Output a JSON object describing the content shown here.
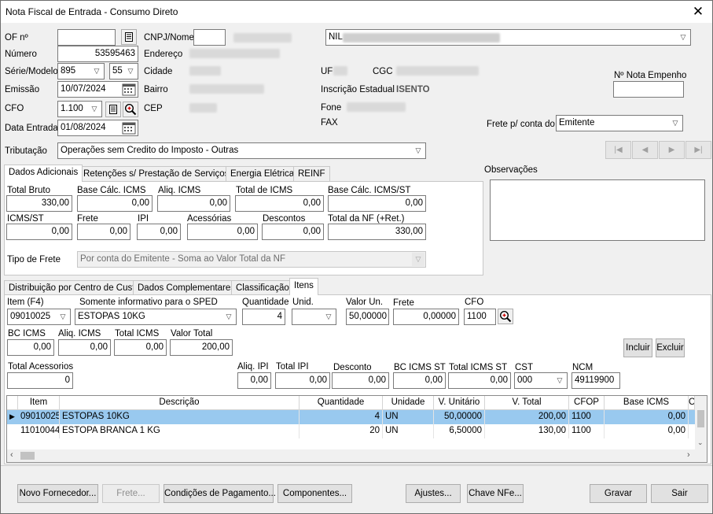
{
  "window": {
    "title": "Nota Fiscal de Entrada - Consumo Direto",
    "close_glyph": "✕"
  },
  "header": {
    "of_label": "OF nº",
    "of_value": "",
    "numero_label": "Número",
    "numero_value": "53595463",
    "serie_label": "Série/Modelo",
    "serie_value": "895",
    "modelo_value": "55",
    "emissao_label": "Emissão",
    "emissao_value": "10/07/2024",
    "cfo_label": "CFO",
    "cfo_value": "1.100",
    "data_entrada_label": "Data Entrada",
    "data_entrada_value": "01/08/2024",
    "tributacao_label": "Tributação",
    "tributacao_value": "Operações sem Credito do Imposto - Outras",
    "cnpj_label": "CNPJ/Nome",
    "cnpj_value": "",
    "nome_value": "NIL",
    "endereco_label": "Endereço",
    "cidade_label": "Cidade",
    "bairro_label": "Bairro",
    "cep_label": "CEP",
    "uf_label": "UF",
    "cgc_label": "CGC",
    "ie_label": "Inscrição Estadual",
    "ie_value": "ISENTO",
    "fone_label": "Fone",
    "fax_label": "FAX",
    "empenho_label": "Nº Nota Empenho",
    "empenho_value": "",
    "frete_conta_label": "Frete p/ conta do",
    "frete_conta_value": "Emitente",
    "observacoes_label": "Observações"
  },
  "nav_buttons": [
    "|◀",
    "◀",
    "▶",
    "▶|"
  ],
  "tabs_top": [
    "Dados Adicionais",
    "Retenções s/ Prestação de Serviços",
    "Energia Elétrica",
    "REINF"
  ],
  "dados_adicionais": {
    "total_bruto_label": "Total Bruto",
    "total_bruto": "330,00",
    "base_icms_label": "Base Cálc. ICMS",
    "base_icms": "0,00",
    "aliq_icms_label": "Aliq. ICMS",
    "aliq_icms": "0,00",
    "total_icms_label": "Total de ICMS",
    "total_icms": "0,00",
    "base_icms_st_label": "Base Cálc. ICMS/ST",
    "base_icms_st": "0,00",
    "icms_st_label": "ICMS/ST",
    "icms_st": "0,00",
    "frete_label": "Frete",
    "frete": "0,00",
    "ipi_label": "IPI",
    "ipi": "0,00",
    "acessorias_label": "Acessórias",
    "acessorias": "0,00",
    "descontos_label": "Descontos",
    "descontos": "0,00",
    "total_nf_label": "Total da NF (+Ret.)",
    "total_nf": "330,00",
    "tipo_frete_label": "Tipo de Frete",
    "tipo_frete_value": "Por conta do Emitente - Soma ao Valor Total da NF"
  },
  "tabs_bottom": [
    "Distribuição por Centro de Custo",
    "Dados Complementares",
    "Classificação",
    "Itens"
  ],
  "itens": {
    "item_label": "Item (F4)",
    "item_value": "09010025",
    "sped_label": "Somente informativo para o SPED",
    "sped_value": "ESTOPAS 10KG",
    "quantidade_label": "Quantidade",
    "quantidade_value": "4",
    "unid_label": "Unid.",
    "unid_value": "",
    "valor_un_label": "Valor Un.",
    "valor_un_value": "50,00000",
    "frete_label": "Frete",
    "frete_value": "0,00000",
    "cfo_label": "CFO",
    "cfo_value": "1100",
    "bc_icms_label": "BC ICMS",
    "bc_icms_value": "0,00",
    "aliq_icms_label": "Aliq. ICMS",
    "aliq_icms_value": "0,00",
    "total_icms_label": "Total ICMS",
    "total_icms_value": "0,00",
    "valor_total_label": "Valor Total",
    "valor_total_value": "200,00",
    "incluir_label": "Incluir",
    "excluir_label": "Excluir",
    "total_acessorios_label": "Total Acessorios",
    "total_acessorios_value": "0",
    "aliq_ipi_label": "Aliq. IPI",
    "aliq_ipi_value": "0,00",
    "total_ipi_label": "Total IPI",
    "total_ipi_value": "0,00",
    "desconto_label": "Desconto",
    "desconto_value": "0,00",
    "bc_icms_st_label": "BC ICMS ST",
    "bc_icms_st_value": "0,00",
    "total_icms_st_label": "Total ICMS ST",
    "total_icms_st_value": "0,00",
    "cst_label": "CST",
    "cst_value": "000",
    "ncm_label": "NCM",
    "ncm_value": "49119900"
  },
  "grid": {
    "columns": [
      "Item",
      "Descrição",
      "Quantidade",
      "Unidade",
      "V. Unitário",
      "V. Total",
      "CFOP",
      "Base ICMS",
      "C"
    ],
    "rows": [
      {
        "item": "09010025",
        "descricao": "ESTOPAS 10KG",
        "quantidade": "4",
        "unidade": "UN",
        "v_unitario": "50,00000",
        "v_total": "200,00",
        "cfop": "1100",
        "base_icms": "0,00"
      },
      {
        "item": "11010044",
        "descricao": "ESTOPA BRANCA 1 KG",
        "quantidade": "20",
        "unidade": "UN",
        "v_unitario": "6,50000",
        "v_total": "130,00",
        "cfop": "1100",
        "base_icms": "0,00"
      }
    ]
  },
  "footer": {
    "novo_fornecedor": "Novo Fornecedor...",
    "frete": "Frete...",
    "condicoes": "Condições de Pagamento...",
    "componentes": "Componentes...",
    "ajustes": "Ajustes...",
    "chave_nfe": "Chave NFe...",
    "gravar": "Gravar",
    "sair": "Sair"
  },
  "colors": {
    "selected_row": "#99c9ef",
    "window_bg": "#f0f0f0"
  }
}
